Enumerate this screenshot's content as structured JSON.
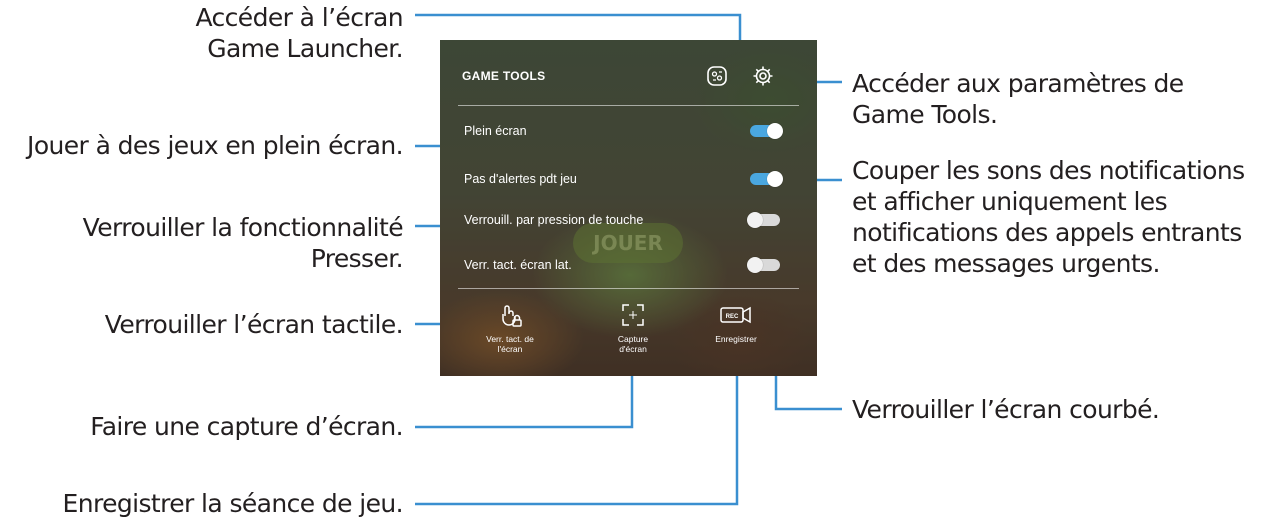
{
  "annotations": {
    "game_launcher": "Accéder à l’écran\nGame Launcher.",
    "full_screen": "Jouer à des jeux en plein écran.",
    "lock_press": "Verrouiller la fonctionnalité\nPresser.",
    "lock_touch": "Verrouiller l’écran tactile.",
    "screenshot": "Faire une capture d’écran.",
    "record": "Enregistrer la séance de jeu.",
    "settings": "Accéder aux paramètres de\nGame Tools.",
    "mute_notifications": "Couper les sons des notifications\net afficher uniquement les\nnotifications des appels entrants\net des messages urgents.",
    "lock_curved": "Verrouiller l’écran courbé."
  },
  "game_tools": {
    "title": "GAME TOOLS",
    "header_icons": [
      "game-launcher-icon",
      "settings-gear-icon"
    ],
    "background_text": "JOUER",
    "options": [
      {
        "label": "Plein écran",
        "enabled": true
      },
      {
        "label": "Pas d'alertes pdt jeu",
        "enabled": true
      },
      {
        "label": "Verrouill. par pression de touche",
        "enabled": false
      },
      {
        "label": "Verr. tact. écran lat.",
        "enabled": false
      }
    ],
    "tools": [
      {
        "label": "Verr. tact. de\nl'écran",
        "icon": "touch-lock-icon"
      },
      {
        "label": "Capture\nd'écran",
        "icon": "screenshot-icon"
      },
      {
        "label": "Enregistrer",
        "icon": "record-icon",
        "icon_text": "REC"
      }
    ]
  },
  "colors": {
    "toggle_on": "#4aa7e0",
    "toggle_off": "#d9d9d9",
    "annotation_text": "#231f20",
    "connector": "#3a8fd0"
  }
}
